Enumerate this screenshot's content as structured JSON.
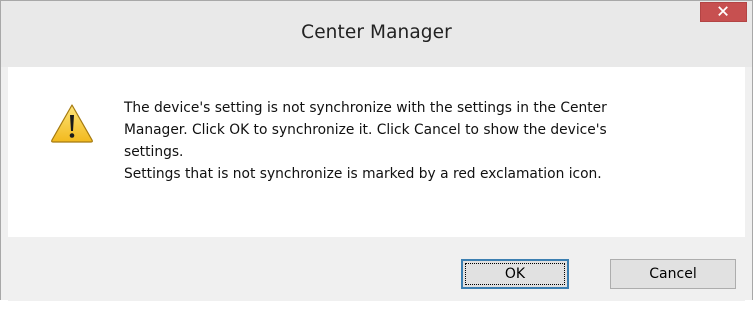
{
  "window": {
    "title": "Center Manager",
    "close_icon": "close-icon",
    "accent_close": "#c75050"
  },
  "dialog": {
    "icon": "warning-icon",
    "message_lines": [
      "The device's setting is not synchronize with the settings in the Center",
      "Manager. Click OK to synchronize it. Click Cancel to show the device's",
      "settings.",
      "Settings that is not synchronize is marked by a red exclamation icon."
    ]
  },
  "buttons": {
    "ok_label": "OK",
    "cancel_label": "Cancel"
  }
}
